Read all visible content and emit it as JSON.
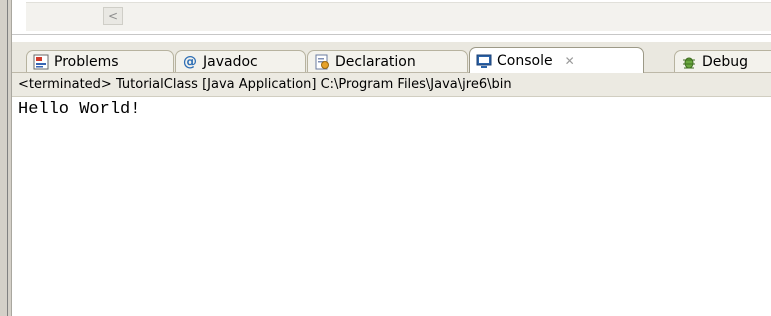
{
  "editor": {
    "scroll_left_glyph": "<"
  },
  "tabs": [
    {
      "label": "Problems",
      "icon": "problems-icon"
    },
    {
      "label": "Javadoc",
      "icon": "javadoc-icon",
      "glyph": "@"
    },
    {
      "label": "Declaration",
      "icon": "declaration-icon"
    },
    {
      "label": "Console",
      "icon": "console-icon",
      "active": true,
      "close_glyph": "✕"
    },
    {
      "label": "Debug",
      "icon": "debug-icon"
    }
  ],
  "console": {
    "status": "<terminated> TutorialClass [Java Application] C:\\Program Files\\Java\\jre6\\bin",
    "output_lines": [
      "Hello World!"
    ]
  },
  "colors": {
    "frame": "#d4d0c8",
    "tab_bar": "#eae8e0",
    "status_bg": "#eceae2",
    "javadoc_icon": "#2f6fb5",
    "console_icon": "#2b63a8",
    "debug_icon": "#4f8a2e"
  }
}
